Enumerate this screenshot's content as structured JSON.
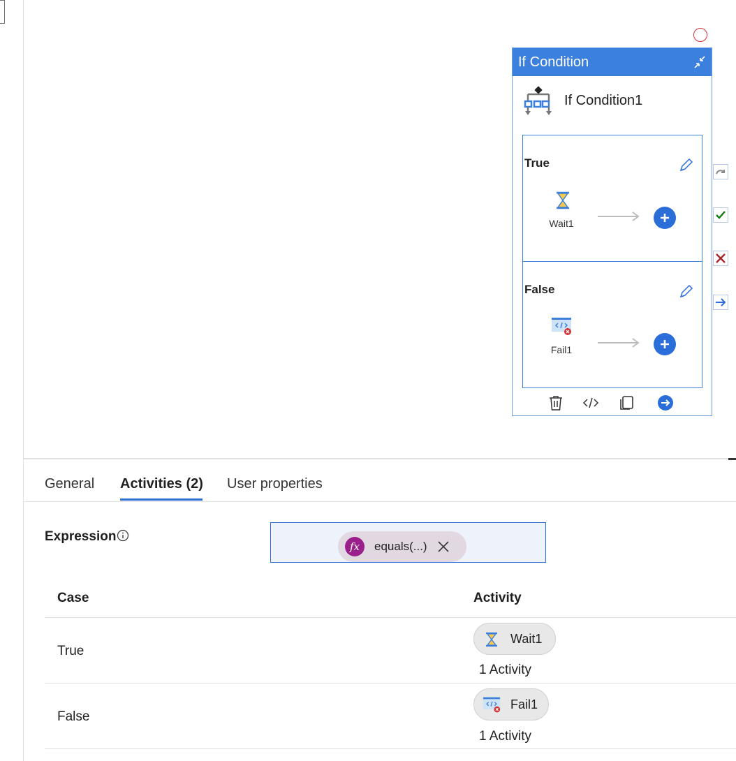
{
  "canvas": {
    "if_card": {
      "header_title": "If Condition",
      "activity_name": "If Condition1",
      "branches": [
        {
          "title": "True",
          "activity_label": "Wait1"
        },
        {
          "title": "False",
          "activity_label": "Fail1"
        }
      ]
    }
  },
  "tabs": [
    {
      "label": "General"
    },
    {
      "label": "Activities (2)"
    },
    {
      "label": "User properties"
    }
  ],
  "active_tab": "Activities (2)",
  "expression": {
    "label": "Expression",
    "chip_text": "equals(...)",
    "fx_glyph": "fx"
  },
  "table": {
    "headers": {
      "case": "Case",
      "activity": "Activity"
    },
    "rows": [
      {
        "case": "True",
        "activity": "Wait1",
        "count": "1 Activity"
      },
      {
        "case": "False",
        "activity": "Fail1",
        "count": "1 Activity"
      }
    ]
  },
  "colors": {
    "accent": "#2b6dd9",
    "header_blue": "#3b80dc",
    "fx_purple": "#9a1f8a",
    "fail_red": "#d13438",
    "success_green": "#107c10"
  }
}
